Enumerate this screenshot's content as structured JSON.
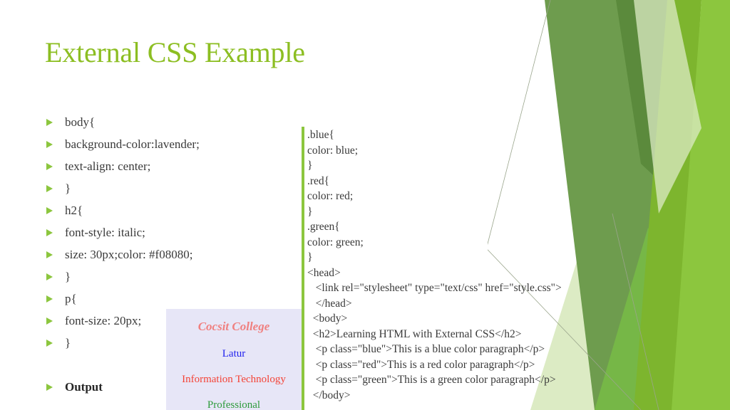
{
  "slide": {
    "title": "External CSS Example",
    "title_color": "#8CBE22",
    "background_color": "#ffffff"
  },
  "bullets": {
    "marker_icon": "triangle-right-icon",
    "marker_color": "#8CC63E",
    "items": [
      {
        "text": "body{",
        "bold": false
      },
      {
        "text": "background-color:lavender;",
        "bold": false
      },
      {
        "text": "text-align: center;",
        "bold": false
      },
      {
        "text": "}",
        "bold": false
      },
      {
        "text": "h2{",
        "bold": false
      },
      {
        "text": "font-style: italic;",
        "bold": false
      },
      {
        "text": "size: 30px;color: #f08080;",
        "bold": false
      },
      {
        "text": "}",
        "bold": false
      },
      {
        "text": "p{",
        "bold": false
      },
      {
        "text": "font-size: 20px;",
        "bold": false
      },
      {
        "text": "}",
        "bold": false
      },
      {
        "text": "",
        "bold": false
      },
      {
        "text": "Output",
        "bold": true
      }
    ]
  },
  "output_box": {
    "background_color": "#E7E6F7",
    "lines": [
      {
        "text": "Cocsit College",
        "color": "#F08080"
      },
      {
        "text": "Latur",
        "color": "#2222EE"
      },
      {
        "text": "Information Technology",
        "color": "#F44336"
      },
      {
        "text": "Professional",
        "color": "#2E9B3C"
      }
    ]
  },
  "code_panel": {
    "accent_bar_color": "#8CC63E",
    "lines": [
      ".blue{",
      "color: blue;",
      "}",
      ".red{",
      "color: red;",
      "}",
      ".green{",
      "color: green;",
      "}",
      "<head>",
      "   <link rel=\"stylesheet\" type=\"text/css\" href=\"style.css\">",
      "   </head>",
      "  <body>",
      "  <h2>Learning HTML with External CSS</h2>",
      "   <p class=\"blue\">This is a blue color paragraph</p>",
      "   <p class=\"red\">This is a red color paragraph</p>",
      "   <p class=\"green\">This is a green color paragraph</p>",
      "  </body>"
    ]
  },
  "decoration": {
    "name": "green-angular-corner-graphic",
    "colors": {
      "sage": "#6E9C4E",
      "dark_olive": "#5B8A3C",
      "bright": "#7DB52E",
      "light_bright": "#8CC63E",
      "mid": "#76B747",
      "pale": "#DCEBC4",
      "very_pale": "#EDF4DF",
      "hairline": "#9aa58c"
    }
  }
}
